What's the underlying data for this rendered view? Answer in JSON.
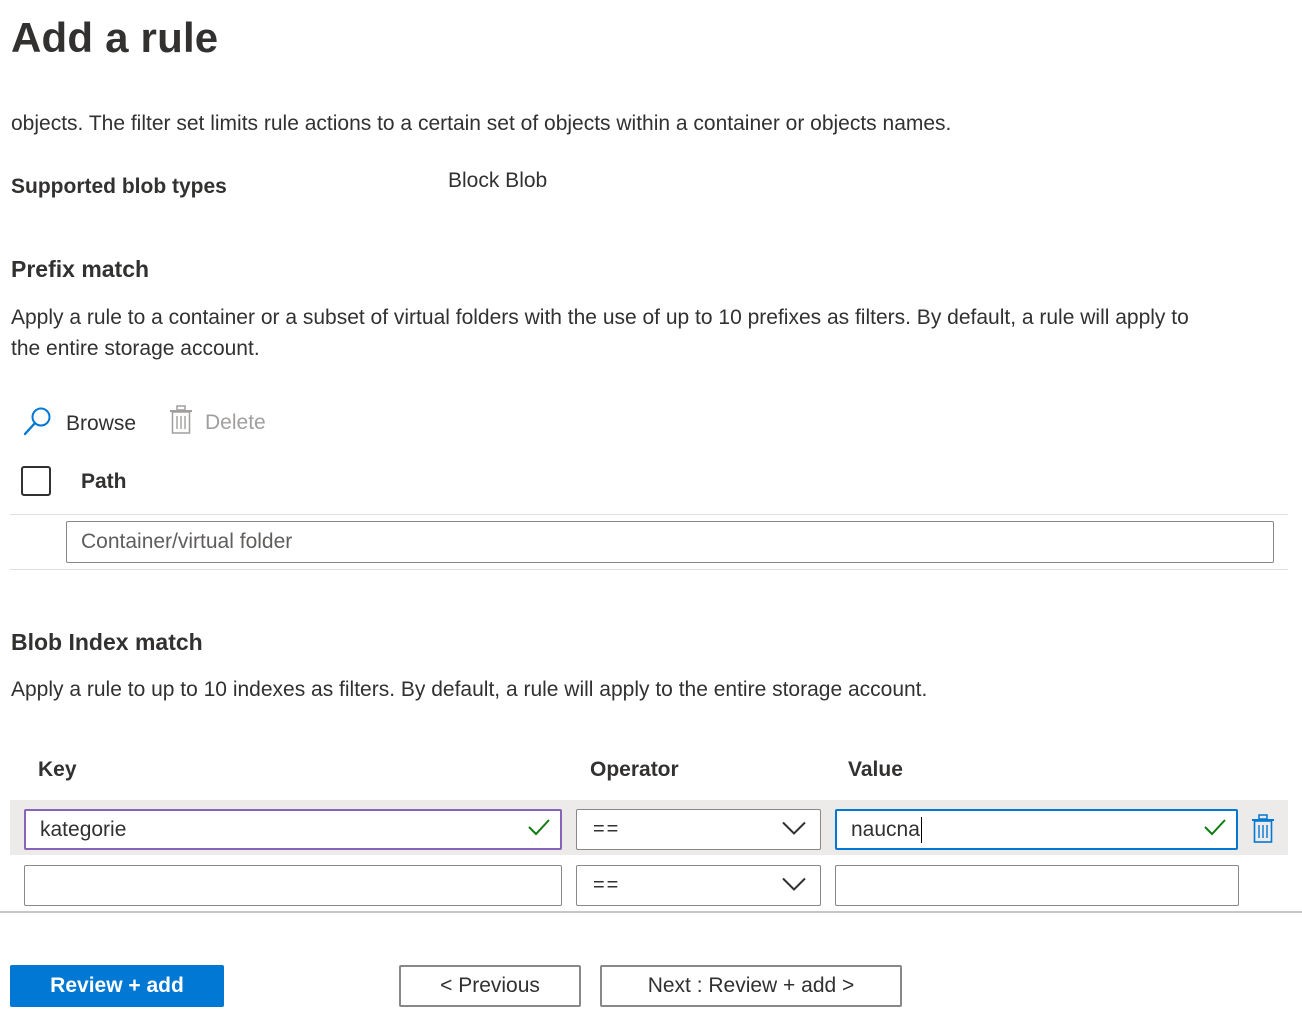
{
  "page": {
    "title": "Add a rule"
  },
  "intro": {
    "text": "objects. The filter set limits rule actions to a certain set of objects within a container or objects names."
  },
  "blob_types": {
    "label": "Supported blob types",
    "value": "Block Blob"
  },
  "prefix_match": {
    "title": "Prefix match",
    "description_line1": "Apply a rule to a container or a subset of virtual folders with the use of up to 10 prefixes as filters. By default, a rule will apply to",
    "description_line2": "the entire storage account.",
    "toolbar": {
      "browse_label": "Browse",
      "delete_label": "Delete"
    },
    "table": {
      "path_header": "Path",
      "path_placeholder": "Container/virtual folder"
    }
  },
  "blob_index_match": {
    "title": "Blob Index match",
    "description": "Apply a rule to up to 10 indexes as filters. By default, a rule will apply to the entire storage account.",
    "headers": {
      "key": "Key",
      "operator": "Operator",
      "value": "Value"
    },
    "rows": [
      {
        "key": "kategorie",
        "operator": "==",
        "value": "naucna"
      },
      {
        "key": "",
        "operator": "==",
        "value": ""
      }
    ]
  },
  "footer": {
    "review_add_label": "Review + add",
    "previous_label": "< Previous",
    "next_label": "Next : Review + add >"
  },
  "colors": {
    "primary": "#0078d4",
    "valid_check": "#107c10",
    "focus_border": "#8764b8",
    "active_border": "#0078d4"
  },
  "icons": {
    "browse": "search-icon",
    "delete": "trash-icon",
    "row_delete": "trash-icon",
    "dropdown": "chevron-down-icon",
    "valid": "checkmark-icon"
  }
}
